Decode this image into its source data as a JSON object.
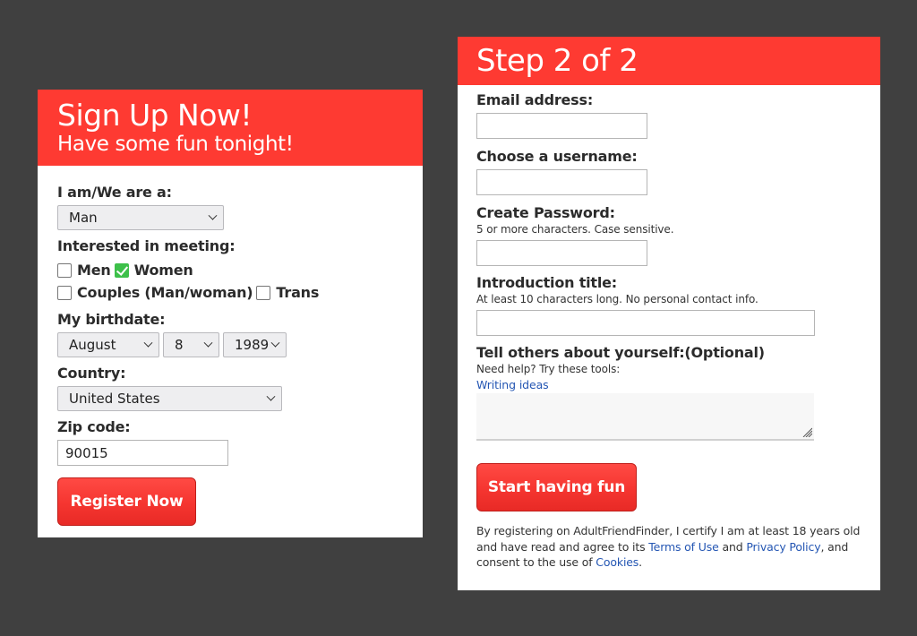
{
  "colors": {
    "background": "#404040",
    "brand_red": "#fe3a32",
    "checkbox_green": "#3dc04a",
    "link_blue": "#2456b3"
  },
  "signup": {
    "title": "Sign Up Now!",
    "subtitle": "Have some fun tonight!",
    "iam_label": "I am/We are a:",
    "iam_value": "Man",
    "interested_label": "Interested in meeting:",
    "options": [
      {
        "label": "Men",
        "checked": false
      },
      {
        "label": "Women",
        "checked": true
      },
      {
        "label": "Couples (Man/woman)",
        "checked": false
      },
      {
        "label": "Trans",
        "checked": false
      }
    ],
    "birthdate_label": "My birthdate:",
    "birth_month": "August",
    "birth_day": "8",
    "birth_year": "1989",
    "country_label": "Country:",
    "country_value": "United States",
    "zip_label": "Zip code:",
    "zip_value": "90015",
    "register_button": "Register Now"
  },
  "step2": {
    "title": "Step 2 of 2",
    "email_label": "Email address:",
    "email_value": "",
    "username_label": "Choose a username:",
    "username_value": "",
    "password_label": "Create Password:",
    "password_hint": "5 or more characters. Case sensitive.",
    "password_value": "",
    "intro_label": "Introduction title:",
    "intro_hint": "At least 10 characters long. No personal contact info.",
    "intro_value": "",
    "about_label": "Tell others about yourself:(Optional)",
    "about_hint": "Need help? Try these tools:",
    "writing_ideas_link": "Writing ideas",
    "about_value": "",
    "submit_button": "Start having fun",
    "legal": {
      "part1": "By registering on AdultFriendFinder, I certify I am at least 18 years old and have read and agree to its ",
      "terms_link": "Terms of Use",
      "part2": " and ",
      "privacy_link": "Privacy Policy",
      "part3": ", and consent to the use of ",
      "cookies_link": "Cookies",
      "part4": "."
    }
  }
}
